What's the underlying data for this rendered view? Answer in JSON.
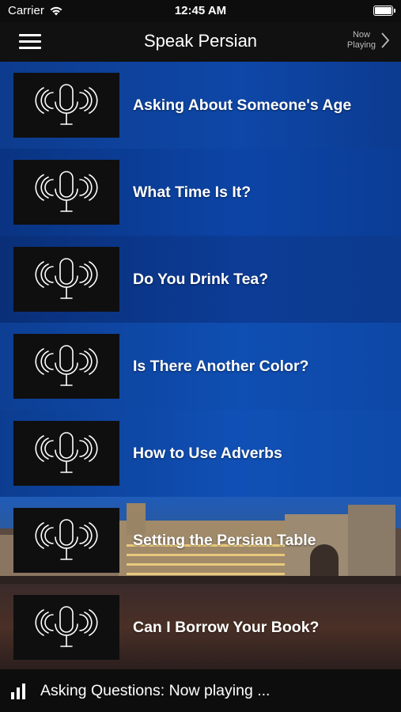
{
  "status_bar": {
    "carrier": "Carrier",
    "time": "12:45 AM"
  },
  "header": {
    "title": "Speak Persian",
    "now_playing_line1": "Now",
    "now_playing_line2": "Playing"
  },
  "lessons": [
    {
      "label": "Asking About Someone's Age",
      "icon": "microphone-icon"
    },
    {
      "label": "What Time Is It?",
      "icon": "microphone-icon"
    },
    {
      "label": "Do You Drink Tea?",
      "icon": "microphone-icon"
    },
    {
      "label": "Is There Another Color?",
      "icon": "microphone-icon"
    },
    {
      "label": "How to Use Adverbs",
      "icon": "microphone-icon"
    },
    {
      "label": "Setting the Persian Table",
      "icon": "microphone-icon"
    },
    {
      "label": "Can I Borrow Your Book?",
      "icon": "microphone-icon"
    }
  ],
  "player": {
    "text": "Asking Questions: Now playing ...",
    "icon": "equalizer-icon"
  }
}
